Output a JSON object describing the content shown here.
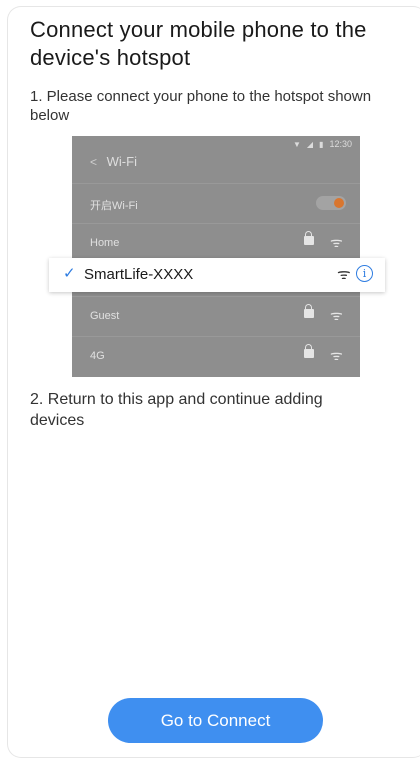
{
  "title": "Connect your mobile phone to the device's hotspot",
  "step1": "1. Please connect your phone to the hotspot shown below",
  "step2": "2. Return to this app and continue adding devices",
  "phone": {
    "time": "12:30",
    "back_glyph": "<",
    "header": "Wi-Fi",
    "rows": {
      "wifi_toggle_label": "开启Wi-Fi",
      "home": "Home",
      "guest": "Guest",
      "cellular": "4G"
    },
    "toggle_on": true
  },
  "selected_network": {
    "check_glyph": "✓",
    "ssid": "SmartLife-XXXX",
    "info_glyph": "i"
  },
  "button": {
    "label": "Go to Connect"
  },
  "colors": {
    "accent": "#3f8ff0",
    "check": "#2f7de1",
    "toggle_knob": "#d9762f",
    "phone_bg": "#8e8e8e"
  }
}
